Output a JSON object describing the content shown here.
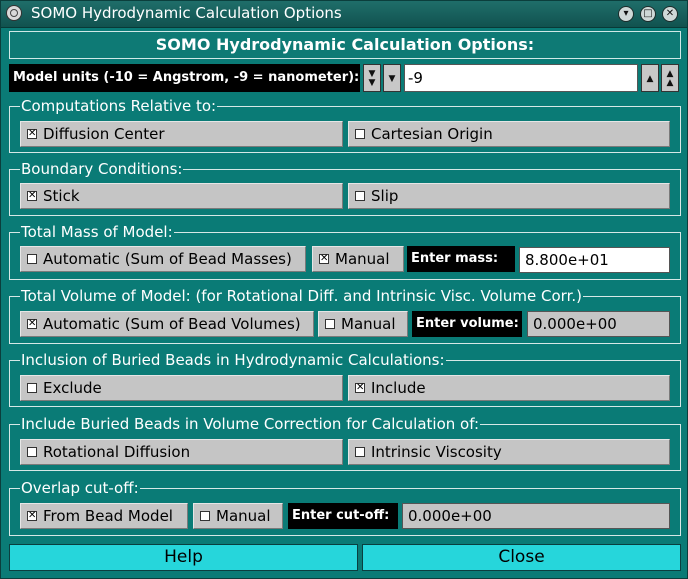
{
  "window": {
    "title": "SOMO Hydrodynamic Calculation Options"
  },
  "header": {
    "title": "SOMO Hydrodynamic Calculation Options:"
  },
  "units": {
    "label": "Model units (-10 = Angstrom, -9 = nanometer):",
    "value": "-9"
  },
  "groups": {
    "computations": {
      "legend": "Computations Relative to:",
      "options": [
        {
          "label": "Diffusion Center",
          "checked": true
        },
        {
          "label": "Cartesian Origin",
          "checked": false
        }
      ]
    },
    "boundary": {
      "legend": "Boundary Conditions:",
      "options": [
        {
          "label": "Stick",
          "checked": true
        },
        {
          "label": "Slip",
          "checked": false
        }
      ]
    },
    "mass": {
      "legend": "Total Mass of Model:",
      "options": [
        {
          "label": "Automatic (Sum of Bead Masses)",
          "checked": false
        },
        {
          "label": "Manual",
          "checked": true
        }
      ],
      "enter_label": "Enter mass:",
      "value": "8.800e+01"
    },
    "volume": {
      "legend": "Total Volume of Model: (for Rotational Diff. and Intrinsic Visc. Volume Corr.)",
      "options": [
        {
          "label": "Automatic (Sum of Bead Volumes)",
          "checked": true
        },
        {
          "label": "Manual",
          "checked": false
        }
      ],
      "enter_label": "Enter volume:",
      "value": "0.000e+00"
    },
    "buried": {
      "legend": "Inclusion of Buried Beads in Hydrodynamic Calculations:",
      "options": [
        {
          "label": "Exclude",
          "checked": false
        },
        {
          "label": "Include",
          "checked": true
        }
      ]
    },
    "volume_correction": {
      "legend": "Include Buried Beads in Volume Correction for Calculation of:",
      "options": [
        {
          "label": "Rotational Diffusion",
          "checked": false
        },
        {
          "label": "Intrinsic Viscosity",
          "checked": false
        }
      ]
    },
    "overlap": {
      "legend": "Overlap cut-off:",
      "options": [
        {
          "label": "From Bead Model",
          "checked": true
        },
        {
          "label": "Manual",
          "checked": false
        }
      ],
      "enter_label": "Enter cut-off:",
      "value": "0.000e+00"
    }
  },
  "buttons": {
    "help": "Help",
    "close": "Close"
  },
  "marks": {
    "checked": "✕",
    "unchecked": ""
  },
  "colors": {
    "background": "#0a7b76",
    "button": "#c5c5c5",
    "accent_button": "#26d6db"
  }
}
